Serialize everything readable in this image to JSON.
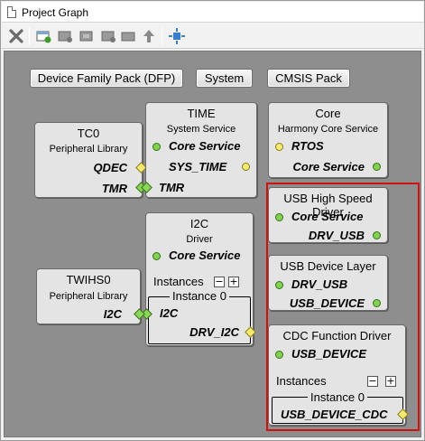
{
  "window": {
    "title": "Project Graph"
  },
  "toolbar": {
    "buttons": [
      {
        "icon": "close-x-icon"
      },
      {
        "icon": "add-component-icon"
      },
      {
        "icon": "component-icon-1"
      },
      {
        "icon": "component-icon-2"
      },
      {
        "icon": "component-icon-3"
      },
      {
        "icon": "component-icon-4"
      },
      {
        "icon": "move-up-icon"
      },
      {
        "icon": "focus-icon"
      }
    ]
  },
  "groups": {
    "dfp": "Device Family Pack (DFP)",
    "system": "System",
    "cmsis": "CMSIS Pack"
  },
  "nodes": {
    "tc0": {
      "title": "TC0",
      "subtitle": "Peripheral Library",
      "ports": [
        "QDEC",
        "TMR"
      ]
    },
    "time": {
      "title": "TIME",
      "subtitle": "System Service",
      "ports": [
        "Core Service",
        "SYS_TIME",
        "TMR"
      ]
    },
    "core": {
      "title": "Core",
      "subtitle": "Harmony Core Service",
      "ports": [
        "RTOS",
        "Core Service"
      ]
    },
    "i2c": {
      "title": "I2C",
      "subtitle": "Driver",
      "ports": [
        "Core Service"
      ],
      "instances_label": "Instances",
      "instance_title": "Instance 0",
      "instance_ports": [
        "I2C",
        "DRV_I2C"
      ]
    },
    "twihs0": {
      "title": "TWIHS0",
      "subtitle": "Peripheral Library",
      "ports": [
        "I2C"
      ]
    },
    "usbhs": {
      "title": "USB High Speed Driver",
      "ports": [
        "Core Service",
        "DRV_USB"
      ]
    },
    "usbdev": {
      "title": "USB Device Layer",
      "ports": [
        "DRV_USB",
        "USB_DEVICE"
      ]
    },
    "cdc": {
      "title": "CDC Function Driver",
      "ports": [
        "USB_DEVICE"
      ],
      "instances_label": "Instances",
      "instance_title": "Instance 0",
      "instance_ports": [
        "USB_DEVICE_CDC"
      ]
    }
  },
  "buttons": {
    "minus": "−",
    "plus": "+"
  },
  "colors": {
    "canvas": "#8e8e8e",
    "node": "#e4e4e4",
    "connected_port": "#7fd34e",
    "open_port": "#f7ea72",
    "highlight": "#d31010"
  }
}
